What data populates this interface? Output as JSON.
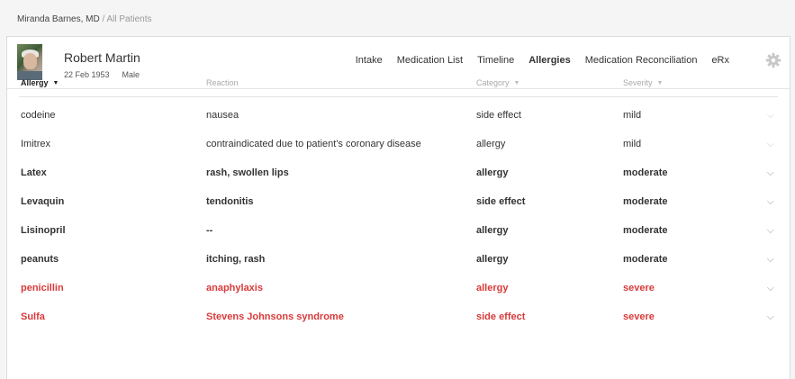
{
  "breadcrumb": {
    "doctor": "Miranda Barnes, MD",
    "separator": " / ",
    "section": "All Patients"
  },
  "patient": {
    "name": "Robert Martin",
    "dob": "22 Feb 1953",
    "sex": "Male"
  },
  "nav": {
    "tabs": [
      {
        "label": "Intake",
        "active": false
      },
      {
        "label": "Medication List",
        "active": false
      },
      {
        "label": "Timeline",
        "active": false
      },
      {
        "label": "Allergies",
        "active": true
      },
      {
        "label": "Medication Reconciliation",
        "active": false
      },
      {
        "label": "eRx",
        "active": false
      }
    ],
    "settings_icon": "gear-icon"
  },
  "table": {
    "columns": {
      "allergy": "Allergy",
      "reaction": "Reaction",
      "category": "Category",
      "severity": "Severity"
    },
    "sort_icon": "caret-down-icon",
    "rows": [
      {
        "allergy": "codeine",
        "reaction": "nausea",
        "category": "side effect",
        "severity": "mild"
      },
      {
        "allergy": "Imitrex",
        "reaction": "contraindicated due to patient's coronary disease",
        "category": "allergy",
        "severity": "mild"
      },
      {
        "allergy": "Latex",
        "reaction": "rash, swollen lips",
        "category": "allergy",
        "severity": "moderate"
      },
      {
        "allergy": "Levaquin",
        "reaction": "tendonitis",
        "category": "side effect",
        "severity": "moderate"
      },
      {
        "allergy": "Lisinopril",
        "reaction": "--",
        "category": "allergy",
        "severity": "moderate"
      },
      {
        "allergy": "peanuts",
        "reaction": "itching, rash",
        "category": "allergy",
        "severity": "moderate"
      },
      {
        "allergy": "penicillin",
        "reaction": "anaphylaxis",
        "category": "allergy",
        "severity": "severe"
      },
      {
        "allergy": "Sulfa",
        "reaction": "Stevens Johnsons syndrome",
        "category": "side effect",
        "severity": "severe"
      }
    ],
    "row_expand_icon": "chevron-down-icon"
  },
  "colors": {
    "severe": "#d93a3a",
    "muted_header": "#aaaaaa",
    "chevron": "#c8c8c8"
  }
}
